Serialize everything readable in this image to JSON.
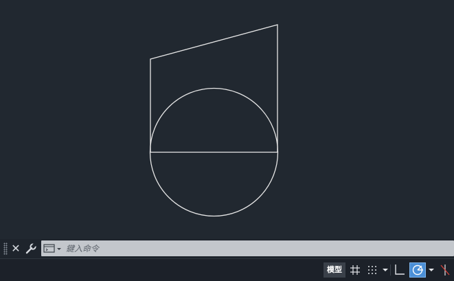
{
  "command_line": {
    "placeholder": "鍵入命令"
  },
  "status_bar": {
    "model_label": "模型"
  },
  "colors": {
    "canvas_bg": "#212830",
    "drawing_lines": "#e6e6e6",
    "command_input_bg": "#c3c7cc",
    "status_active": "#4b8fd6"
  },
  "icons": [
    "close-icon",
    "wrench-icon",
    "command-prompt-icon",
    "grid-icon",
    "snap-icon",
    "ortho-icon",
    "polar-tracking-icon",
    "isodraft-icon"
  ]
}
